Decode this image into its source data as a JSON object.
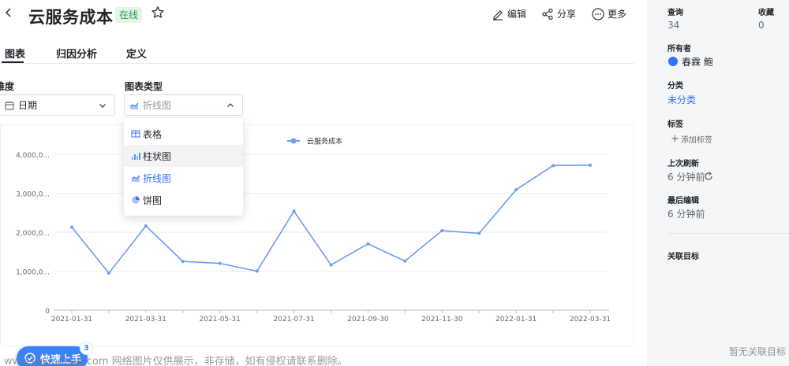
{
  "header": {
    "title": "云服务成本",
    "status": "在线",
    "actions": [
      {
        "label": "编辑",
        "icon": "pen-icon"
      },
      {
        "label": "分享",
        "icon": "share-icon"
      },
      {
        "label": "更多",
        "icon": "more-icon"
      }
    ]
  },
  "tabs": [
    {
      "label": "图表",
      "active": true
    },
    {
      "label": "归因分析",
      "active": false
    },
    {
      "label": "定义",
      "active": false
    }
  ],
  "dimension": {
    "label": "维度",
    "value": "日期"
  },
  "chart_type": {
    "label": "图表类型",
    "value": "折线图",
    "options": [
      {
        "label": "表格",
        "icon": "table-icon"
      },
      {
        "label": "柱状图",
        "icon": "bar-chart-icon"
      },
      {
        "label": "折线图",
        "icon": "line-chart-icon",
        "selected": true
      },
      {
        "label": "饼图",
        "icon": "pie-chart-icon"
      }
    ]
  },
  "chart_data": {
    "type": "line",
    "legend": "云服务成本",
    "legend_position": "top-center",
    "grid": true,
    "x": [
      "2021-01-31",
      "2021-02-28",
      "2021-03-31",
      "2021-04-30",
      "2021-05-31",
      "2021-06-30",
      "2021-07-31",
      "2021-08-31",
      "2021-09-30",
      "2021-10-31",
      "2021-11-30",
      "2021-12-31",
      "2022-01-31",
      "2022-02-28",
      "2022-03-31"
    ],
    "x_tick_labels": [
      "2021-01-31",
      "2021-03-31",
      "2021-05-31",
      "2021-07-31",
      "2021-09-30",
      "2021-11-30",
      "2022-01-31",
      "2022-03-31"
    ],
    "series": [
      {
        "name": "云服务成本",
        "values": [
          2130000,
          950000,
          2160000,
          1250000,
          1200000,
          1000000,
          2540000,
          1160000,
          1700000,
          1260000,
          2040000,
          1970000,
          3090000,
          3710000,
          3720000
        ]
      }
    ],
    "y_tick_labels": [
      "0",
      "1,000,0...",
      "2,000,0...",
      "3,000,0...",
      "4,000,0..."
    ],
    "ylim": [
      0,
      4000000
    ],
    "color": "#6b9cf2"
  },
  "right_panel": {
    "views_label": "查询",
    "views_value": "34",
    "favorites_label": "收藏",
    "favorites_value": "0",
    "owner_label": "所有者",
    "owner_name": "春霖 鲍",
    "category_label": "分类",
    "category_value": "未分类",
    "tags_label": "标签",
    "add_tag_label": "添加标签",
    "last_refresh_label": "上次刷新",
    "last_refresh_value": "6 分钟前",
    "last_edit_label": "最后编辑",
    "last_edit_value": "6 分钟前",
    "related_label": "关联目标",
    "no_related": "暂无关联目标"
  },
  "quickstart": {
    "label": "快速上手",
    "badge": "3"
  },
  "watermark": "www.toymoban.com 网络图片仅供展示，非存储，如有侵权请联系删除。",
  "colors": {
    "accent": "#3370ff",
    "line": "#6b9cf2",
    "badge_bg": "#e3f5e6",
    "badge_text": "#2a9b45"
  }
}
